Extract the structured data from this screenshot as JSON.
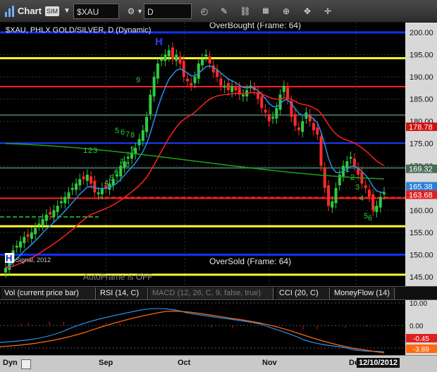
{
  "toolbar": {
    "chart_label": "Chart",
    "badge": "SIM",
    "symbol": "$XAU",
    "period": "D",
    "icons": [
      "symbol-dropdown-icon",
      "settings-gear-icon",
      "interval-dropdown-icon",
      "refresh-clock-icon",
      "draw-pencil-icon",
      "link-chain-icon",
      "bar-type-icon",
      "zoom-icon",
      "tools-icon"
    ]
  },
  "chart": {
    "title": "$XAU, PHLX GOLD/SILVER, D (Dynamic)",
    "overbought_label": "OverBought (Frame: 64)",
    "oversold_label": "OverSold (Frame: 64)",
    "autoframe_label": "AutoFrame is OFF",
    "copyright": "© eSignal, 2012",
    "dyn_label": "Dyn",
    "peak_marker": "H",
    "left_marker": "H",
    "seq_labels": [
      "1",
      "2",
      "3",
      "4",
      "5",
      "6",
      "7",
      "8",
      "9",
      "5",
      "6",
      "7",
      "8",
      "9",
      "1",
      "2",
      "3",
      "4",
      "5",
      "6",
      "7"
    ],
    "y_ticks": [
      "200.00",
      "195.00",
      "190.00",
      "185.00",
      "180.00",
      "175.00",
      "170.00",
      "165.00",
      "160.00",
      "155.00",
      "150.00",
      "145.00"
    ],
    "price_tags": [
      {
        "value": "178.78",
        "color": "#d01010"
      },
      {
        "value": "169.32",
        "color": "#4a6b55"
      },
      {
        "value": "165.38",
        "color": "#2a7fd4"
      },
      {
        "value": "163.68",
        "color": "#e02020"
      }
    ],
    "levels": {
      "overbought": 200.0,
      "oversold": 150.0,
      "yellow": [
        194.2,
        156.4,
        145.5
      ],
      "red": [
        187.8,
        162.7
      ],
      "blue": [
        175.1
      ],
      "teal": [
        181.4,
        169.5
      ]
    },
    "colors": {
      "up": "#2ecc40",
      "down": "#ff2a2a",
      "bg": "#000000",
      "grid": "#333333"
    }
  },
  "x_labels": [
    "Sep",
    "Oct",
    "Nov",
    "Dec"
  ],
  "date_badge": "12/10/2012",
  "tabs": [
    {
      "label": "Vol (current price bar)",
      "active": true
    },
    {
      "label": "RSI (14, C)",
      "active": true
    },
    {
      "label": "MACD (12, 26, C, 9, false, true)",
      "active": false
    },
    {
      "label": "CCI (20, C)",
      "active": true
    },
    {
      "label": "MoneyFlow (14)",
      "active": true
    }
  ],
  "macd": {
    "y_ticks": [
      "10.00",
      "0.00"
    ],
    "value_tags": [
      {
        "value": "-0.45",
        "color": "#e02020"
      },
      {
        "value": "-3.89",
        "color": "#ff6a10"
      }
    ]
  },
  "chart_data": {
    "type": "candlestick",
    "title": "$XAU, PHLX GOLD/SILVER, D (Dynamic)",
    "ylim": [
      143,
      202
    ],
    "closes": [
      147,
      149,
      151,
      152,
      153,
      154,
      154,
      155,
      156,
      157,
      158,
      159,
      159,
      160,
      161,
      162,
      163,
      164,
      165,
      166,
      167,
      167,
      168,
      166,
      164,
      164,
      165,
      165,
      166,
      167,
      168,
      170,
      171,
      172,
      173,
      174,
      176,
      178,
      181,
      186,
      190,
      193,
      194,
      195,
      196,
      194,
      195,
      193,
      190,
      189,
      188,
      190,
      193,
      194,
      195,
      193,
      191,
      190,
      188,
      188,
      187,
      188,
      187,
      186,
      186,
      187,
      188,
      187,
      185,
      183,
      182,
      180,
      181,
      183,
      186,
      188,
      185,
      181,
      179,
      178,
      180,
      182,
      180,
      178,
      177,
      170,
      165,
      161,
      162,
      165,
      168,
      170,
      171,
      172,
      170,
      168,
      166,
      165,
      163,
      160,
      161,
      163,
      164
    ],
    "ema_fast_last": 165.38,
    "ema_mid_last": 169.32,
    "sma_slow_last": 178.78,
    "last": 163.68
  }
}
